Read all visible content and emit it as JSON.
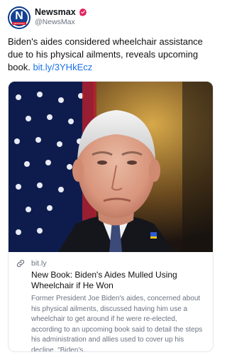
{
  "account": {
    "display_name": "Newsmax",
    "handle": "@NewsMax",
    "avatar_letter": "N",
    "avatar_caption": "NEWSMAX",
    "verified_color": "#e0245e"
  },
  "post": {
    "text": "Biden's aides considered wheelchair assistance due to his physical ailments, reveals upcoming book.",
    "link": "bit.ly/3YHkEcz"
  },
  "card": {
    "domain": "bit.ly",
    "title": "New Book: Biden's Aides Mulled Using Wheelchair if He Won",
    "description": "Former President Joe Biden's aides, concerned about his physical ailments, discussed having him use a wheelchair to get around if he were re-elected, according to an upcoming book said to detail the steps his administration and allies used to cover up his decline. \"Biden's..."
  },
  "icons": {
    "verified": "verified-badge-icon",
    "link": "link-icon"
  },
  "colors": {
    "link": "#1a73e8",
    "muted": "#6b7280",
    "brand_blue": "#0b3a8a"
  }
}
